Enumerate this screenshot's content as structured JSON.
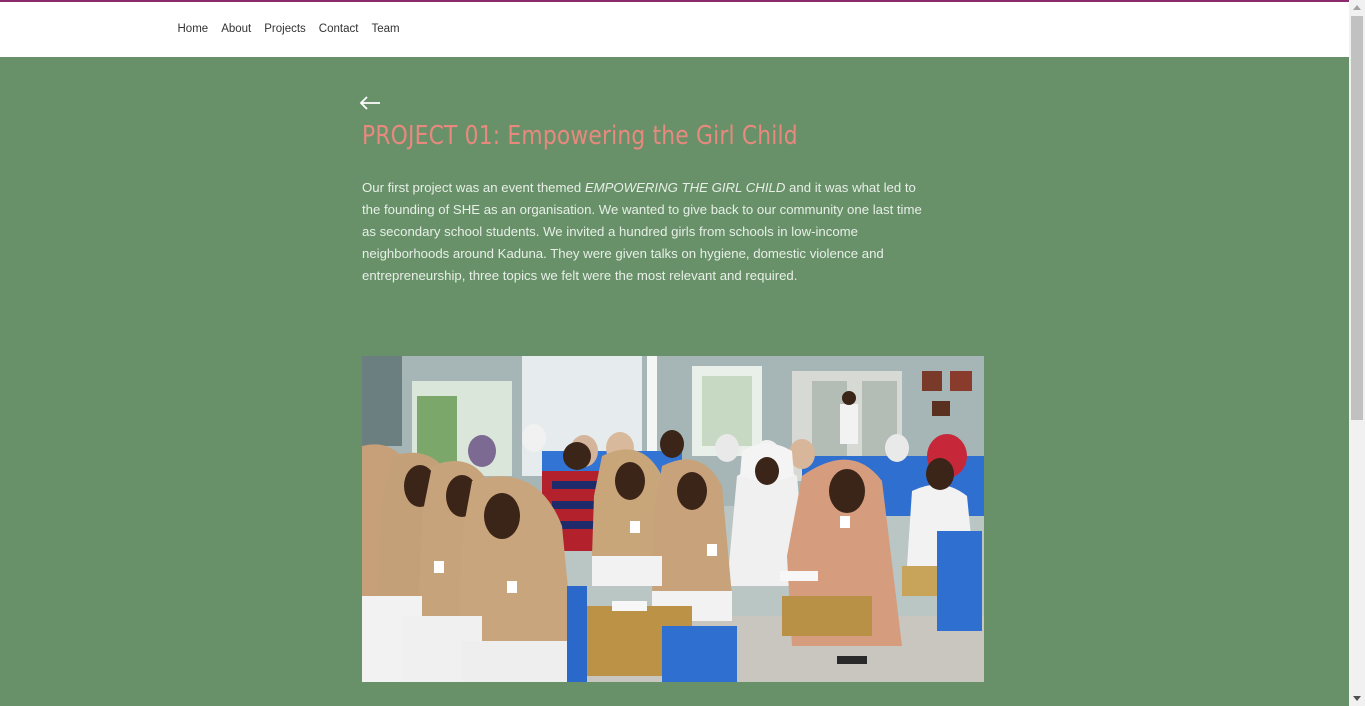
{
  "nav": {
    "items": [
      "Home",
      "About",
      "Projects",
      "Contact",
      "Team"
    ]
  },
  "project": {
    "title": "PROJECT 01: Empowering the Girl Child",
    "intro_before": "Our first project was an event themed ",
    "theme": "EMPOWERING THE GIRL CHILD",
    "intro_after": "  and it was what led to the founding of SHE as an organisation. We wanted to give back to our community one last time as secondary school students. We invited a hundred girls from schools in low-income neighborhoods around Kaduna. They were given talks on hygiene, domestic violence and entrepreneurship, three topics we felt were the most relevant and required."
  },
  "colors": {
    "accent_bar": "#8b2b6e",
    "background": "#68916a",
    "title": "#e8897e",
    "body_text": "#e7efe6"
  },
  "icons": {
    "back": "arrow-left-icon"
  }
}
